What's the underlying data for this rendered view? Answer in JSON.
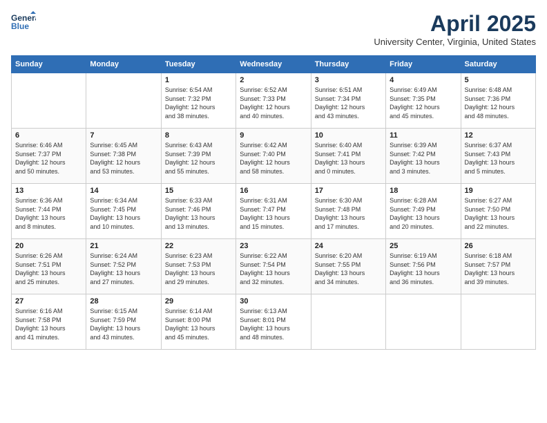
{
  "header": {
    "logo_line1": "General",
    "logo_line2": "Blue",
    "month": "April 2025",
    "location": "University Center, Virginia, United States"
  },
  "columns": [
    "Sunday",
    "Monday",
    "Tuesday",
    "Wednesday",
    "Thursday",
    "Friday",
    "Saturday"
  ],
  "weeks": [
    [
      {
        "day": "",
        "detail": ""
      },
      {
        "day": "",
        "detail": ""
      },
      {
        "day": "1",
        "detail": "Sunrise: 6:54 AM\nSunset: 7:32 PM\nDaylight: 12 hours\nand 38 minutes."
      },
      {
        "day": "2",
        "detail": "Sunrise: 6:52 AM\nSunset: 7:33 PM\nDaylight: 12 hours\nand 40 minutes."
      },
      {
        "day": "3",
        "detail": "Sunrise: 6:51 AM\nSunset: 7:34 PM\nDaylight: 12 hours\nand 43 minutes."
      },
      {
        "day": "4",
        "detail": "Sunrise: 6:49 AM\nSunset: 7:35 PM\nDaylight: 12 hours\nand 45 minutes."
      },
      {
        "day": "5",
        "detail": "Sunrise: 6:48 AM\nSunset: 7:36 PM\nDaylight: 12 hours\nand 48 minutes."
      }
    ],
    [
      {
        "day": "6",
        "detail": "Sunrise: 6:46 AM\nSunset: 7:37 PM\nDaylight: 12 hours\nand 50 minutes."
      },
      {
        "day": "7",
        "detail": "Sunrise: 6:45 AM\nSunset: 7:38 PM\nDaylight: 12 hours\nand 53 minutes."
      },
      {
        "day": "8",
        "detail": "Sunrise: 6:43 AM\nSunset: 7:39 PM\nDaylight: 12 hours\nand 55 minutes."
      },
      {
        "day": "9",
        "detail": "Sunrise: 6:42 AM\nSunset: 7:40 PM\nDaylight: 12 hours\nand 58 minutes."
      },
      {
        "day": "10",
        "detail": "Sunrise: 6:40 AM\nSunset: 7:41 PM\nDaylight: 13 hours\nand 0 minutes."
      },
      {
        "day": "11",
        "detail": "Sunrise: 6:39 AM\nSunset: 7:42 PM\nDaylight: 13 hours\nand 3 minutes."
      },
      {
        "day": "12",
        "detail": "Sunrise: 6:37 AM\nSunset: 7:43 PM\nDaylight: 13 hours\nand 5 minutes."
      }
    ],
    [
      {
        "day": "13",
        "detail": "Sunrise: 6:36 AM\nSunset: 7:44 PM\nDaylight: 13 hours\nand 8 minutes."
      },
      {
        "day": "14",
        "detail": "Sunrise: 6:34 AM\nSunset: 7:45 PM\nDaylight: 13 hours\nand 10 minutes."
      },
      {
        "day": "15",
        "detail": "Sunrise: 6:33 AM\nSunset: 7:46 PM\nDaylight: 13 hours\nand 13 minutes."
      },
      {
        "day": "16",
        "detail": "Sunrise: 6:31 AM\nSunset: 7:47 PM\nDaylight: 13 hours\nand 15 minutes."
      },
      {
        "day": "17",
        "detail": "Sunrise: 6:30 AM\nSunset: 7:48 PM\nDaylight: 13 hours\nand 17 minutes."
      },
      {
        "day": "18",
        "detail": "Sunrise: 6:28 AM\nSunset: 7:49 PM\nDaylight: 13 hours\nand 20 minutes."
      },
      {
        "day": "19",
        "detail": "Sunrise: 6:27 AM\nSunset: 7:50 PM\nDaylight: 13 hours\nand 22 minutes."
      }
    ],
    [
      {
        "day": "20",
        "detail": "Sunrise: 6:26 AM\nSunset: 7:51 PM\nDaylight: 13 hours\nand 25 minutes."
      },
      {
        "day": "21",
        "detail": "Sunrise: 6:24 AM\nSunset: 7:52 PM\nDaylight: 13 hours\nand 27 minutes."
      },
      {
        "day": "22",
        "detail": "Sunrise: 6:23 AM\nSunset: 7:53 PM\nDaylight: 13 hours\nand 29 minutes."
      },
      {
        "day": "23",
        "detail": "Sunrise: 6:22 AM\nSunset: 7:54 PM\nDaylight: 13 hours\nand 32 minutes."
      },
      {
        "day": "24",
        "detail": "Sunrise: 6:20 AM\nSunset: 7:55 PM\nDaylight: 13 hours\nand 34 minutes."
      },
      {
        "day": "25",
        "detail": "Sunrise: 6:19 AM\nSunset: 7:56 PM\nDaylight: 13 hours\nand 36 minutes."
      },
      {
        "day": "26",
        "detail": "Sunrise: 6:18 AM\nSunset: 7:57 PM\nDaylight: 13 hours\nand 39 minutes."
      }
    ],
    [
      {
        "day": "27",
        "detail": "Sunrise: 6:16 AM\nSunset: 7:58 PM\nDaylight: 13 hours\nand 41 minutes."
      },
      {
        "day": "28",
        "detail": "Sunrise: 6:15 AM\nSunset: 7:59 PM\nDaylight: 13 hours\nand 43 minutes."
      },
      {
        "day": "29",
        "detail": "Sunrise: 6:14 AM\nSunset: 8:00 PM\nDaylight: 13 hours\nand 45 minutes."
      },
      {
        "day": "30",
        "detail": "Sunrise: 6:13 AM\nSunset: 8:01 PM\nDaylight: 13 hours\nand 48 minutes."
      },
      {
        "day": "",
        "detail": ""
      },
      {
        "day": "",
        "detail": ""
      },
      {
        "day": "",
        "detail": ""
      }
    ]
  ]
}
